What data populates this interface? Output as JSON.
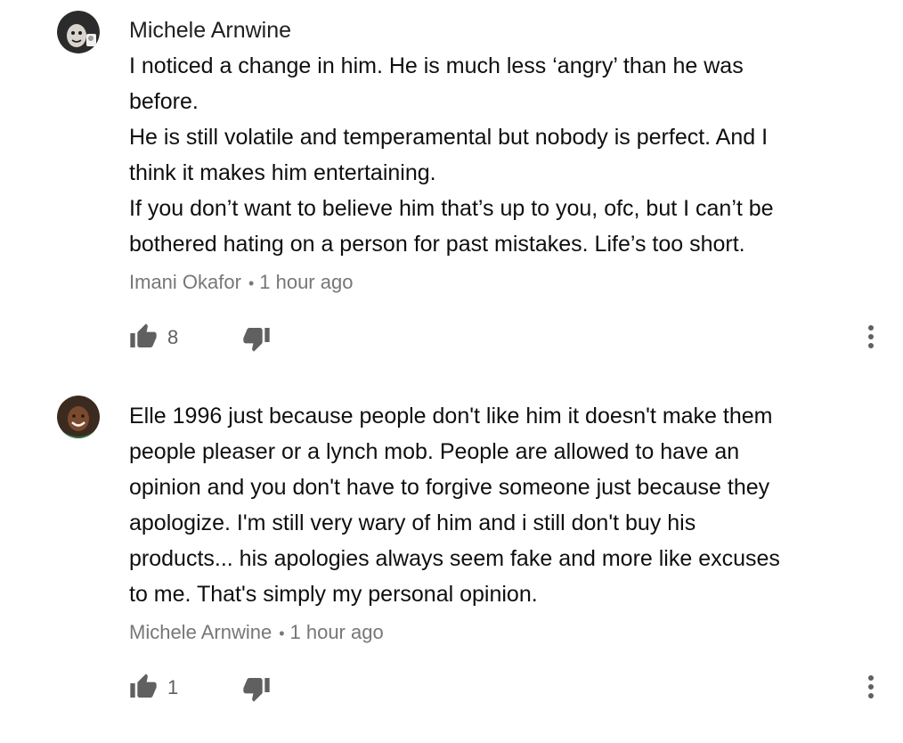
{
  "comments": [
    {
      "author": "Michele Arnwine",
      "lines": [
        "I noticed a change in him. He is much less ‘angry’ than he was",
        "before.",
        "He is still volatile and temperamental but nobody is perfect. And I",
        "think it makes him entertaining.",
        "If you don’t want to believe him that’s up to you, ofc,  but I can’t be",
        "bothered hating on a person for past mistakes. Life’s too short."
      ],
      "reply_to": "Imani Okafor",
      "separator": "•",
      "time": "1 hour ago",
      "likes": "8",
      "avatar_icon": "profile-photo",
      "colors": {
        "avatar_bg": "#2a2a2a"
      }
    },
    {
      "author": "",
      "lines": [
        "Elle 1996 just because people don't like him it doesn't make them",
        "people pleaser or a lynch mob. People are allowed to have an",
        "opinion and you don't have to forgive someone just because they",
        "apologize. I'm still very wary of him and i still don't buy his",
        "products... his apologies always seem fake and more like excuses",
        "to me. That's simply my personal opinion."
      ],
      "reply_to": "Michele Arnwine",
      "separator": "•",
      "time": "1 hour ago",
      "likes": "1",
      "avatar_icon": "profile-photo",
      "colors": {
        "avatar_bg": "#6b3a22"
      }
    }
  ],
  "icons": {
    "like": "thumbs-up-icon",
    "dislike": "thumbs-down-icon",
    "more": "more-vertical-icon"
  },
  "colors": {
    "text": "#0f0f0f",
    "meta": "#777777",
    "icon": "#606060"
  }
}
